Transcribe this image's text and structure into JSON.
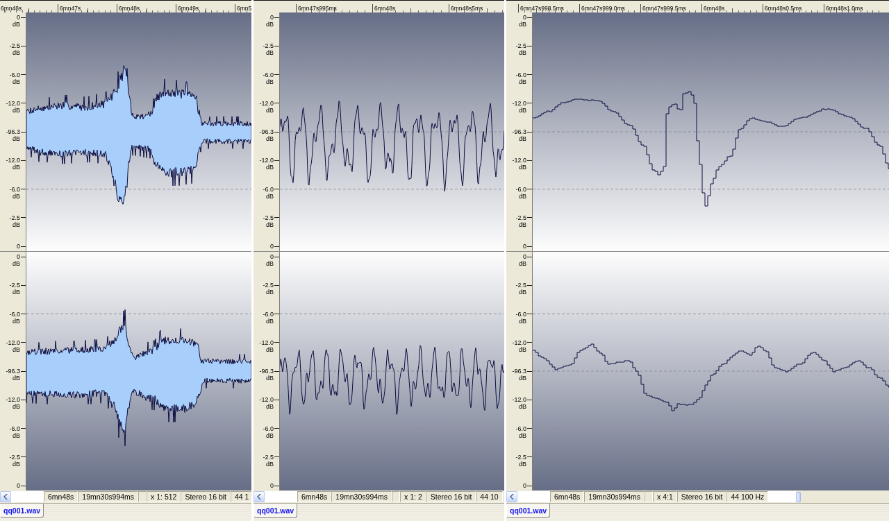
{
  "panes": [
    {
      "kind": "envelope",
      "ruler": [
        "6mn46s",
        "6mn47s",
        "6mn48s",
        "6mn49s",
        "6mn5"
      ],
      "channels": [
        {
          "scale": [
            {
              "value": "0",
              "unit": "dB"
            },
            {
              "value": "-2.5",
              "unit": "dB"
            },
            {
              "value": "-6.0",
              "unit": "dB"
            },
            {
              "value": "-12.0",
              "unit": "dB"
            },
            {
              "value": "-96.3",
              "unit": "dB"
            },
            {
              "value": "-12.0",
              "unit": "dB"
            },
            {
              "value": "-6.0",
              "unit": "dB"
            },
            {
              "value": "-2.5",
              "unit": "dB"
            },
            {
              "value": "0"
            }
          ]
        },
        {
          "scale": [
            {
              "value": "0",
              "unit": "dB"
            },
            {
              "value": "-2.5",
              "unit": "dB"
            },
            {
              "value": "-6.0",
              "unit": "dB"
            },
            {
              "value": "-12.0",
              "unit": "dB"
            },
            {
              "value": "-96.3",
              "unit": "dB"
            },
            {
              "value": "-12.0",
              "unit": "dB"
            },
            {
              "value": "-6.0",
              "unit": "dB"
            },
            {
              "value": "-2.5",
              "unit": "dB"
            },
            {
              "value": "0"
            }
          ]
        }
      ],
      "status_bar": {
        "position": "6mn48s",
        "length": "19mn30s994ms",
        "zoom": "x 1: 512",
        "format": "Stereo 16 bit",
        "sample_rate": "44 1"
      },
      "tabs": [
        {
          "label": "qq001.wav",
          "selected": true
        }
      ]
    },
    {
      "kind": "line",
      "ruler": [
        "6mn47s995ms",
        "6mn48s",
        "6mn48s5ms"
      ],
      "channels": [
        {
          "scale": [
            {
              "value": "0",
              "unit": "dB"
            },
            {
              "value": "-2.5",
              "unit": "dB"
            },
            {
              "value": "-6.0",
              "unit": "dB"
            },
            {
              "value": "-12.0",
              "unit": "dB"
            },
            {
              "value": "-96.3",
              "unit": "dB"
            },
            {
              "value": "-12.0",
              "unit": "dB"
            },
            {
              "value": "-6.0",
              "unit": "dB"
            },
            {
              "value": "-2.5",
              "unit": "dB"
            },
            {
              "value": "0"
            }
          ]
        },
        {
          "scale": [
            {
              "value": "0",
              "unit": "dB"
            },
            {
              "value": "-2.5",
              "unit": "dB"
            },
            {
              "value": "-6.0",
              "unit": "dB"
            },
            {
              "value": "-12.0",
              "unit": "dB"
            },
            {
              "value": "-96.3",
              "unit": "dB"
            },
            {
              "value": "-12.0",
              "unit": "dB"
            },
            {
              "value": "-6.0",
              "unit": "dB"
            },
            {
              "value": "-2.5",
              "unit": "dB"
            },
            {
              "value": "0"
            }
          ]
        }
      ],
      "status_bar": {
        "position": "6mn48s",
        "length": "19mn30s994ms",
        "zoom": "x 1: 2",
        "format": "Stereo 16 bit",
        "sample_rate": "44 10"
      },
      "tabs": [
        {
          "label": "qq001.wav",
          "selected": true
        }
      ]
    },
    {
      "kind": "step",
      "ruler": [
        "6mn47s998.5ms",
        "6mn47s999.0ms",
        "6mn47s999.5ms",
        "6mn48s",
        "6mn48s0.5ms",
        "6mn48s1.0ms"
      ],
      "channels": [
        {
          "scale": [
            {
              "value": "0",
              "unit": "dB"
            },
            {
              "value": "-2.5",
              "unit": "dB"
            },
            {
              "value": "-6.0",
              "unit": "dB"
            },
            {
              "value": "-12.0",
              "unit": "dB"
            },
            {
              "value": "-96.3",
              "unit": "dB"
            },
            {
              "value": "-12.0",
              "unit": "dB"
            },
            {
              "value": "-6.0",
              "unit": "dB"
            },
            {
              "value": "-2.5",
              "unit": "dB"
            },
            {
              "value": "0"
            }
          ]
        },
        {
          "scale": [
            {
              "value": "0",
              "unit": "dB"
            },
            {
              "value": "-2.5",
              "unit": "dB"
            },
            {
              "value": "-6.0",
              "unit": "dB"
            },
            {
              "value": "-12.0",
              "unit": "dB"
            },
            {
              "value": "-96.3",
              "unit": "dB"
            },
            {
              "value": "-12.0",
              "unit": "dB"
            },
            {
              "value": "-6.0",
              "unit": "dB"
            },
            {
              "value": "-2.5",
              "unit": "dB"
            },
            {
              "value": "0"
            }
          ]
        }
      ],
      "status_bar": {
        "position": "6mn48s",
        "length": "19mn30s994ms",
        "zoom": "x 4:1",
        "format": "Stereo 16 bit",
        "sample_rate": "44 100 Hz"
      },
      "tabs": [
        {
          "label": "qq001.wav",
          "selected": true
        }
      ]
    }
  ]
}
